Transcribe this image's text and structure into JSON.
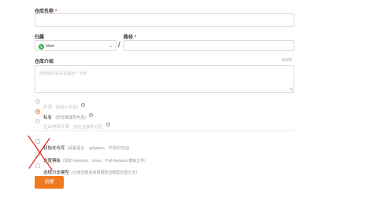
{
  "form": {
    "repo_name": {
      "label": "仓库名称",
      "required_mark": "*",
      "value": ""
    },
    "owner": {
      "label": "归属",
      "avatar_letter": "V",
      "selected": "Vam"
    },
    "path": {
      "label": "路径",
      "required_mark": "*",
      "separator": "/",
      "value": ""
    },
    "description": {
      "label": "仓库介绍",
      "counter": "0/100",
      "placeholder": "用简短的语言来描述一下吧"
    },
    "visibility": {
      "options": [
        {
          "label": "开源",
          "hint": "(所有人可见)",
          "selected": false
        },
        {
          "label": "私有",
          "hint": "(仅仓库成员可见)",
          "selected": true
        },
        {
          "label": "企业内部开源",
          "hint": "(仅企业成员可见)",
          "selected": false
        }
      ]
    },
    "init_options": [
      {
        "label": "初始化仓库",
        "hint": "(设置语言、.gitignore、开源许可证)",
        "checked": false
      },
      {
        "label": "设置模板",
        "hint": "(添加 Readme、Issue、Pull Request 模板文件)",
        "checked": false
      },
      {
        "label": "选择分支模型",
        "hint": "(仓库创建后将根据所选模型创建分支)",
        "checked": false
      }
    ],
    "submit_label": "创建"
  },
  "colors": {
    "accent": "#f0781e",
    "owner_avatar": "#35b34a",
    "annotation": "#e02020"
  }
}
